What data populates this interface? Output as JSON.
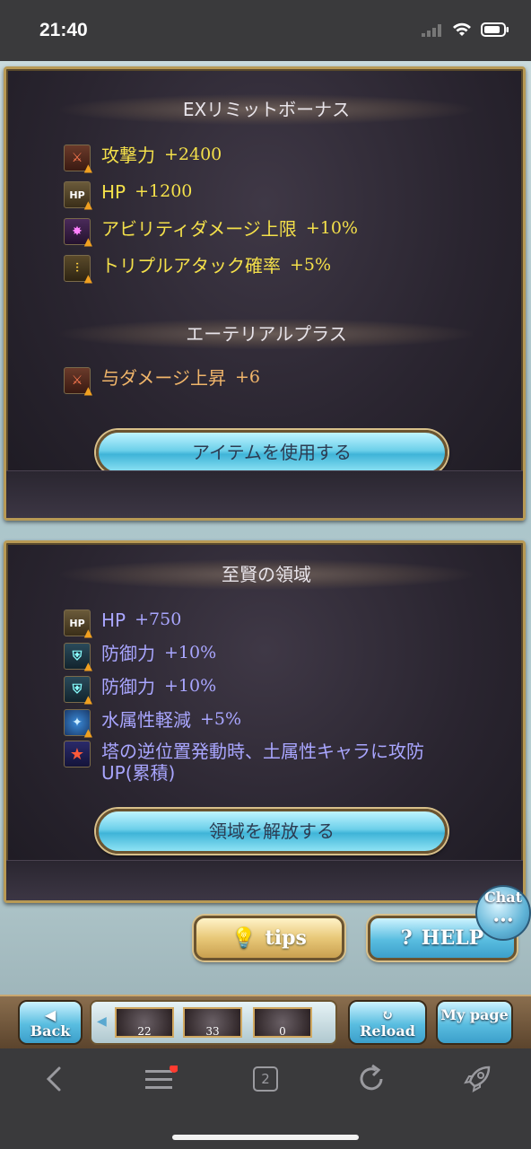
{
  "status": {
    "time": "21:40"
  },
  "panel1": {
    "title": "EXリミットボーナス",
    "items": [
      {
        "icon": "sword-up-icon",
        "label": "攻撃力",
        "value": "+2400"
      },
      {
        "icon": "hp-up-icon",
        "label": "HP",
        "value": "+1200"
      },
      {
        "icon": "ability-damage-icon",
        "label": "アビリティダメージ上限",
        "value": "+10%"
      },
      {
        "icon": "triple-attack-icon",
        "label": "トリプルアタック確率",
        "value": "+5%"
      }
    ],
    "subtitle": "エーテリアルプラス",
    "sub_items": [
      {
        "icon": "sword-up-icon",
        "label": "与ダメージ上昇",
        "value": "+6"
      }
    ],
    "button": "アイテムを使用する"
  },
  "panel2": {
    "title": "至賢の領域",
    "items": [
      {
        "icon": "hp-up-icon",
        "label": "HP",
        "value": "+750"
      },
      {
        "icon": "defense-up-icon",
        "label": "防御力",
        "value": "+10%"
      },
      {
        "icon": "defense-up-icon",
        "label": "防御力",
        "value": "+10%"
      },
      {
        "icon": "water-resist-icon",
        "label": "水属性軽減",
        "value": "+5%"
      },
      {
        "icon": "star-icon",
        "label": "塔の逆位置発動時、土属性キャラに攻防UP(累積)",
        "value": ""
      }
    ],
    "button": "領域を解放する"
  },
  "actions": {
    "tips": "tips",
    "help": "HELP",
    "chat": "Chat"
  },
  "game_nav": {
    "back": "Back",
    "reload": "Reload",
    "mypage": "My page",
    "thumbs": [
      "22",
      "33",
      "0"
    ]
  },
  "browser": {
    "tabs_count": "2"
  },
  "colors": {
    "yellow_text": "#f4e04a",
    "orange_text": "#f0b56a",
    "blue_text": "#a9a6ff",
    "panel_border": "#b89a55"
  }
}
